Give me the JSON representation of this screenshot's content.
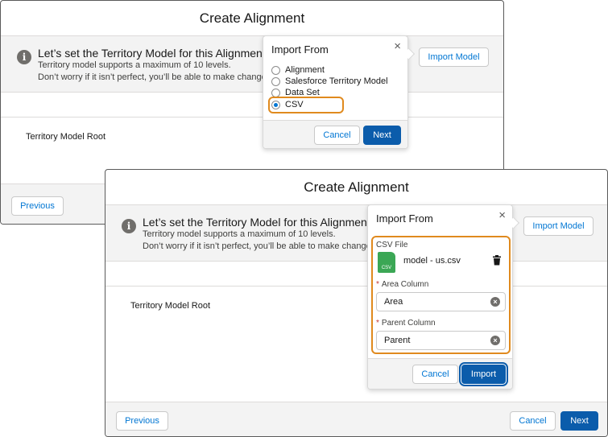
{
  "dialog": {
    "title": "Create Alignment",
    "banner_title": "Let’s set the Territory Model for this Alignment",
    "banner_line1": "Territory model supports a maximum of 10 levels.",
    "banner_line2": "Don’t worry if it isn’t perfect, you’ll be able to make changes a",
    "banner_line2_front": "Don’t worry if it isn’t perfect, you’ll be able to make changes a",
    "root_label": "Territory Model Root",
    "import_model_label": "Import Model",
    "previous_label": "Previous",
    "cancel_label": "Cancel",
    "next_label": "Next"
  },
  "import_popover": {
    "title": "Import From",
    "close": "×",
    "options": [
      "Alignment",
      "Salesforce Territory Model",
      "Data Set",
      "CSV"
    ],
    "selected": "CSV",
    "cancel_label": "Cancel",
    "next_label": "Next"
  },
  "csv_popover": {
    "title": "Import From",
    "close": "×",
    "file_label": "CSV File",
    "file_icon_text": "CSV",
    "file_name": "model - us.csv",
    "required_mark": "*",
    "area_label": "Area Column",
    "area_value": "Area",
    "parent_label": "Parent Column",
    "parent_value": "Parent",
    "clear": "×",
    "cancel_label": "Cancel",
    "import_label": "Import"
  },
  "colors": {
    "brand": "#0b5cab",
    "link": "#0176d3",
    "highlight": "#e08a1e",
    "csv_file": "#3ba755"
  }
}
